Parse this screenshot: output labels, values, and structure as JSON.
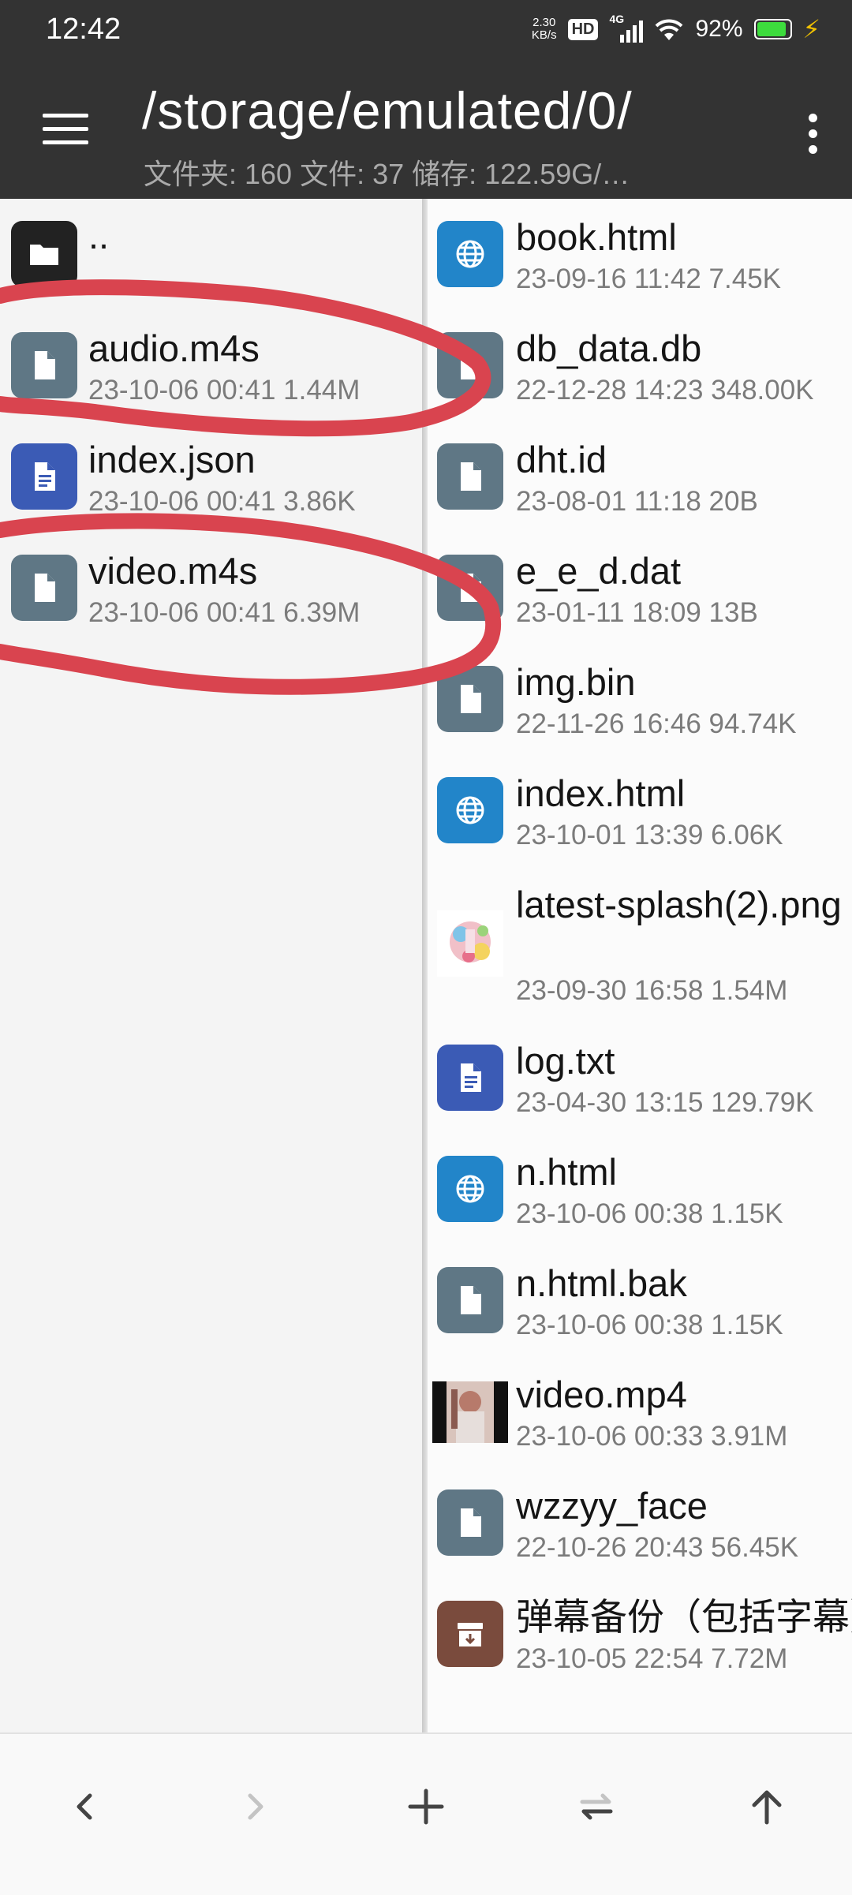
{
  "status": {
    "time": "12:42",
    "net_speed_value": "2.30",
    "net_speed_unit": "KB/s",
    "hd": "HD",
    "signal_type": "4G",
    "battery_level": "92%",
    "battery_fraction": 0.92,
    "battery_color": "#3ddc3d"
  },
  "app_bar": {
    "title": "/storage/emulated/0/",
    "subtitle": "文件夹: 160  文件: 37  储存: 122.59G/…",
    "background": "#333333"
  },
  "left_pane": {
    "items": [
      {
        "name": "..",
        "meta": "",
        "icon": "folder-icon"
      },
      {
        "name": "audio.m4s",
        "meta": "23-10-06 00:41  1.44M",
        "icon": "file-icon"
      },
      {
        "name": "index.json",
        "meta": "23-10-06 00:41  3.86K",
        "icon": "document-icon"
      },
      {
        "name": "video.m4s",
        "meta": "23-10-06 00:41  6.39M",
        "icon": "file-icon"
      }
    ]
  },
  "right_pane": {
    "items": [
      {
        "name": "book.html",
        "meta": "23-09-16 11:42  7.45K",
        "icon": "globe-icon"
      },
      {
        "name": "db_data.db",
        "meta": "22-12-28 14:23  348.00K",
        "icon": "file-icon"
      },
      {
        "name": "dht.id",
        "meta": "23-08-01 11:18  20B",
        "icon": "file-icon"
      },
      {
        "name": "e_e_d.dat",
        "meta": "23-01-11 18:09  13B",
        "icon": "file-icon"
      },
      {
        "name": "img.bin",
        "meta": "22-11-26 16:46  94.74K",
        "icon": "file-icon"
      },
      {
        "name": "index.html",
        "meta": "23-10-01 13:39  6.06K",
        "icon": "globe-icon"
      },
      {
        "name": "latest-splash(2).png",
        "meta": "23-09-30 16:58  1.54M",
        "icon": "image-thumbnail-icon"
      },
      {
        "name": "log.txt",
        "meta": "23-04-30 13:15  129.79K",
        "icon": "document-icon"
      },
      {
        "name": "n.html",
        "meta": "23-10-06 00:38  1.15K",
        "icon": "globe-icon"
      },
      {
        "name": "n.html.bak",
        "meta": "23-10-06 00:38  1.15K",
        "icon": "file-icon"
      },
      {
        "name": "video.mp4",
        "meta": "23-10-06 00:33  3.91M",
        "icon": "video-thumbnail-icon"
      },
      {
        "name": "wzzyy_face",
        "meta": "22-10-26 20:43  56.45K",
        "icon": "file-icon"
      },
      {
        "name": "弹幕备份（包括字幕）.zip",
        "meta": "23-10-05 22:54  7.72M",
        "icon": "archive-icon"
      }
    ]
  },
  "bottom_nav": {
    "buttons": [
      "back-icon",
      "forward-icon",
      "add-icon",
      "swap-icon",
      "up-icon"
    ]
  },
  "annotation_color": "#d9444f"
}
